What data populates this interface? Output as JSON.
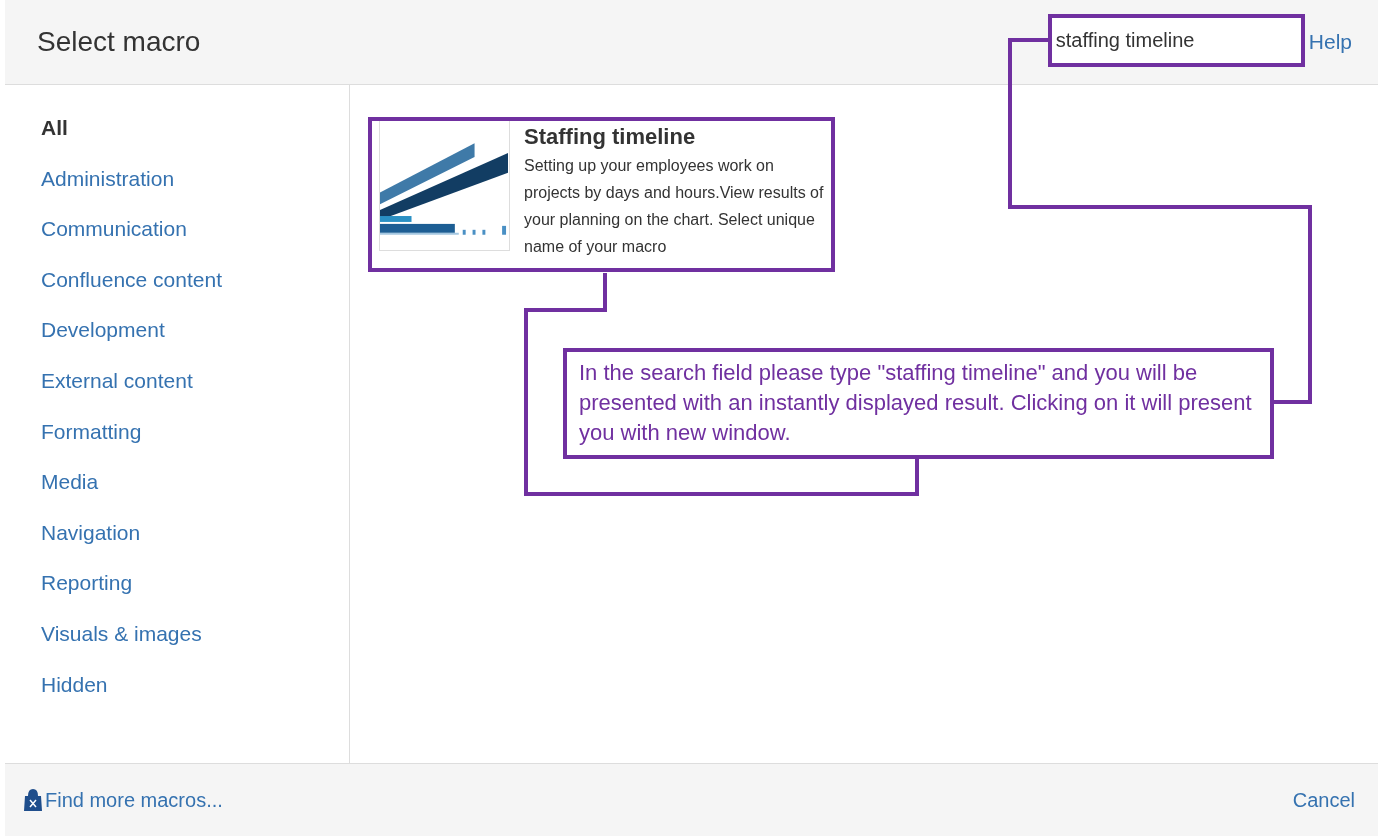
{
  "dialog": {
    "title": "Select macro",
    "search": {
      "value": "staffing timeline"
    },
    "help": "Help"
  },
  "categories": [
    {
      "label": "All",
      "selected": true
    },
    {
      "label": "Administration",
      "selected": false
    },
    {
      "label": "Communication",
      "selected": false
    },
    {
      "label": "Confluence content",
      "selected": false
    },
    {
      "label": "Development",
      "selected": false
    },
    {
      "label": "External content",
      "selected": false
    },
    {
      "label": "Formatting",
      "selected": false
    },
    {
      "label": "Media",
      "selected": false
    },
    {
      "label": "Navigation",
      "selected": false
    },
    {
      "label": "Reporting",
      "selected": false
    },
    {
      "label": "Visuals & images",
      "selected": false
    },
    {
      "label": "Hidden",
      "selected": false
    }
  ],
  "results": [
    {
      "title": "Staffing timeline",
      "description": "Setting up your employees work on projects by days and hours.View results of your planning on the chart. Select unique name of your macro"
    }
  ],
  "callout": "In the search field please type \"staffing timeline\" and you will be presented with an instantly displayed result. Clicking on it will present you with new window.",
  "footer": {
    "link": "Find more macros...",
    "cancel": "Cancel"
  }
}
